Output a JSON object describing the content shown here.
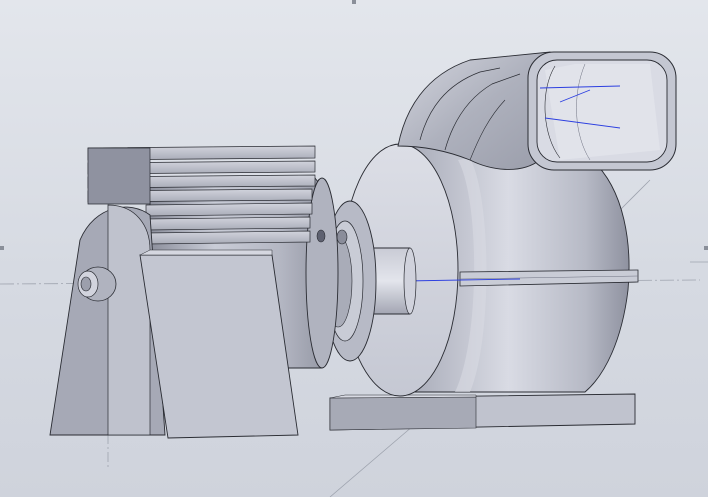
{
  "viewport": {
    "background_top": "#e3e6ec",
    "background_bottom": "#cfd3dc"
  },
  "model": {
    "body_color": "#b9bcc8",
    "shadow_color": "#7c7f8c",
    "highlight_color": "#e4e6ee",
    "edge_color": "#2a2c33",
    "sketch_line_color": "#2b3ee0",
    "construction_line_color": "#9ea3ae"
  },
  "icons": {
    "selection_handles": "square-handle-icon"
  }
}
